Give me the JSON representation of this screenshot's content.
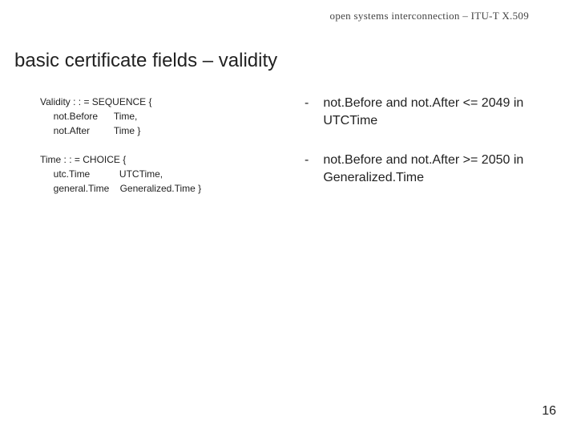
{
  "header": "open systems interconnection – ITU-T X.509",
  "title": "basic certificate fields – validity",
  "code": {
    "block1": {
      "l1": "Validity : : = SEQUENCE {",
      "l2": "     not.Before      Time,",
      "l3": "     not.After         Time }"
    },
    "block2": {
      "l1": "Time : : = CHOICE {",
      "l2": "     utc.Time           UTCTime,",
      "l3": "     general.Time    Generalized.Time }"
    }
  },
  "bullets": {
    "dash": "-",
    "b1": "not.Before and not.After <= 2049 in UTCTime",
    "b2": "not.Before and not.After >= 2050 in Generalized.Time"
  },
  "page_number": "16"
}
